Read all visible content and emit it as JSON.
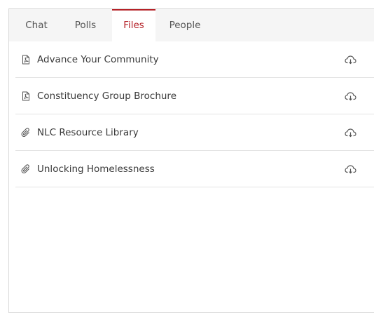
{
  "tabs": [
    {
      "label": "Chat",
      "active": false
    },
    {
      "label": "Polls",
      "active": false
    },
    {
      "label": "Files",
      "active": true
    },
    {
      "label": "People",
      "active": false
    }
  ],
  "colors": {
    "accent": "#b52228",
    "tab_bar_bg": "#f5f5f5",
    "divider": "#e3e3e3",
    "text": "#3a3a3a"
  },
  "files": [
    {
      "name": "Advance Your Community",
      "icon": "pdf-file-icon",
      "action_icon": "cloud-download-icon"
    },
    {
      "name": "Constituency Group Brochure",
      "icon": "pdf-file-icon",
      "action_icon": "cloud-download-icon"
    },
    {
      "name": "NLC Resource Library",
      "icon": "paperclip-icon",
      "action_icon": "cloud-download-icon"
    },
    {
      "name": "Unlocking Homelessness",
      "icon": "paperclip-icon",
      "action_icon": "cloud-download-icon"
    }
  ]
}
